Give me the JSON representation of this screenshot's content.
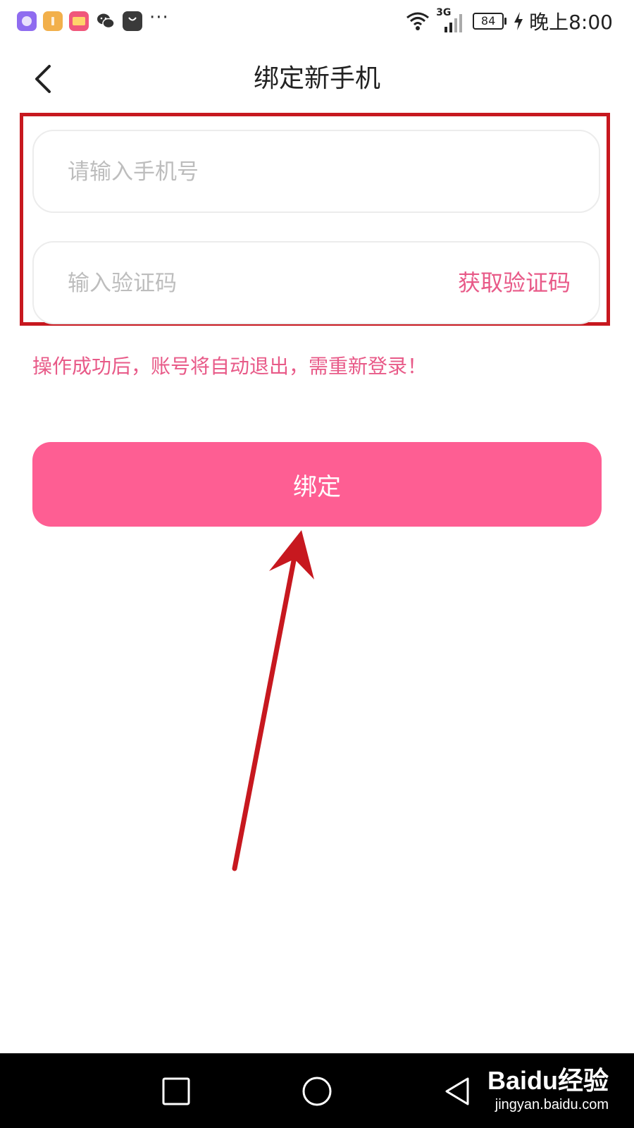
{
  "status_bar": {
    "battery": "84",
    "network": "3G",
    "time": "晚上8:00",
    "more": "···",
    "icons": [
      "gallery-icon",
      "folder-icon",
      "wallet-icon",
      "wechat-icon",
      "app-store-icon",
      "wifi-icon",
      "signal-icon",
      "battery-icon",
      "charging-icon"
    ]
  },
  "header": {
    "title": "绑定新手机"
  },
  "form": {
    "phone_placeholder": "请输入手机号",
    "phone_value": "",
    "code_placeholder": "输入验证码",
    "code_value": "",
    "get_code_label": "获取验证码"
  },
  "warning": "操作成功后，账号将自动退出，需重新登录！",
  "bind_button": "绑定",
  "nav_bar": {
    "icons": [
      "recent-apps-icon",
      "home-icon",
      "back-icon"
    ]
  },
  "watermark": {
    "brand": "Baidu经验",
    "url": "jingyan.baidu.com"
  },
  "colors": {
    "accent": "#fe5e93",
    "accent_text": "#e85a88",
    "annotation": "#c7181f"
  }
}
